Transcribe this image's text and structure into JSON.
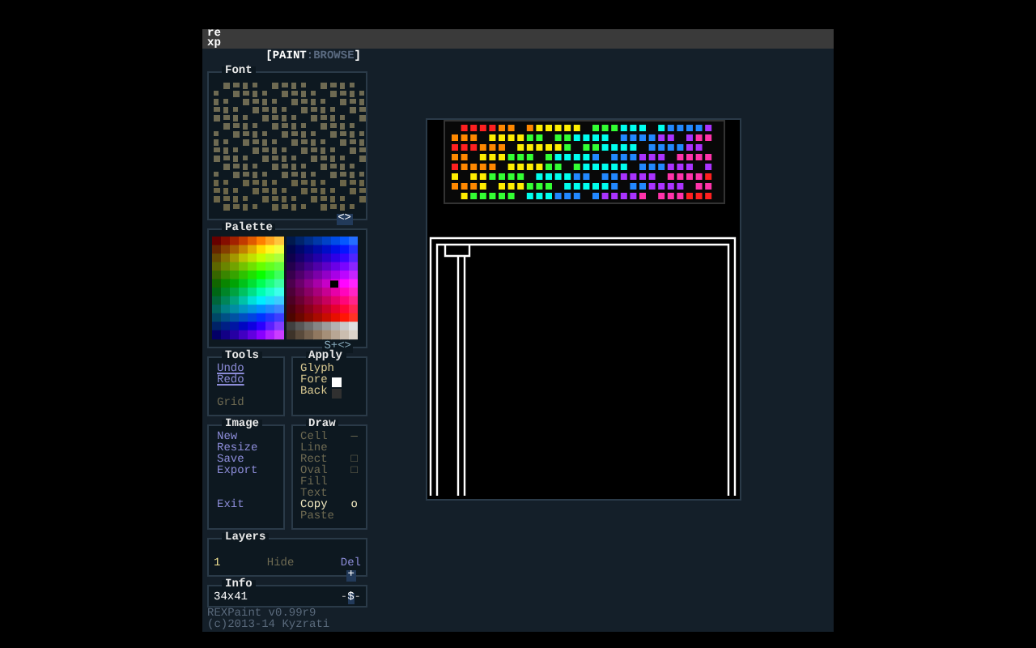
{
  "logo": "re xp",
  "mode": {
    "parts": [
      {
        "label": "PAINT",
        "selected": true
      },
      {
        "label": "BROWSE",
        "selected": false
      }
    ],
    "open": "[",
    "sep": ":",
    "close": "]"
  },
  "font_panel": {
    "title": "Font",
    "scroll": "<>"
  },
  "palette_panel": {
    "title": "Palette",
    "scroll": "S+<>"
  },
  "tools": {
    "title": "Tools",
    "items": [
      {
        "label": "Undo",
        "disabled": false
      },
      {
        "label": "Redo",
        "disabled": false
      },
      {
        "label": "Grid",
        "disabled": true,
        "spaced": true
      }
    ]
  },
  "apply": {
    "title": "Apply",
    "items": [
      {
        "label": "Glyph",
        "kind": "plain"
      },
      {
        "label": "Fore",
        "kind": "toggle",
        "checked": true
      },
      {
        "label": "Back",
        "kind": "toggle",
        "checked": false
      }
    ]
  },
  "image": {
    "title": "Image",
    "items": [
      {
        "label": "New"
      },
      {
        "label": "Resize"
      },
      {
        "label": "Save"
      },
      {
        "label": "Export"
      },
      {
        "label": "Exit",
        "spaced": true
      }
    ]
  },
  "draw": {
    "title": "Draw",
    "items": [
      {
        "label": "Cell",
        "mark": "—",
        "selected": false
      },
      {
        "label": "Line",
        "selected": false
      },
      {
        "label": "Rect",
        "mark": "□",
        "selected": false
      },
      {
        "label": "Oval",
        "mark": "□",
        "selected": false
      },
      {
        "label": "Fill",
        "selected": false
      },
      {
        "label": "Text",
        "selected": false
      },
      {
        "label": "Copy",
        "mark": "o",
        "selected": true
      },
      {
        "label": "Paste",
        "selected": false
      }
    ]
  },
  "layers": {
    "title": "Layers",
    "rows": [
      {
        "number": "1",
        "hide": "Hide",
        "del": "Del"
      }
    ],
    "add": "+"
  },
  "info": {
    "title": "Info",
    "size": "34x41",
    "marks": [
      "-",
      "-"
    ],
    "glyph": "$"
  },
  "footer": [
    "REXPaint v0.99r9",
    "(c)2013-14 Kyzrati"
  ]
}
